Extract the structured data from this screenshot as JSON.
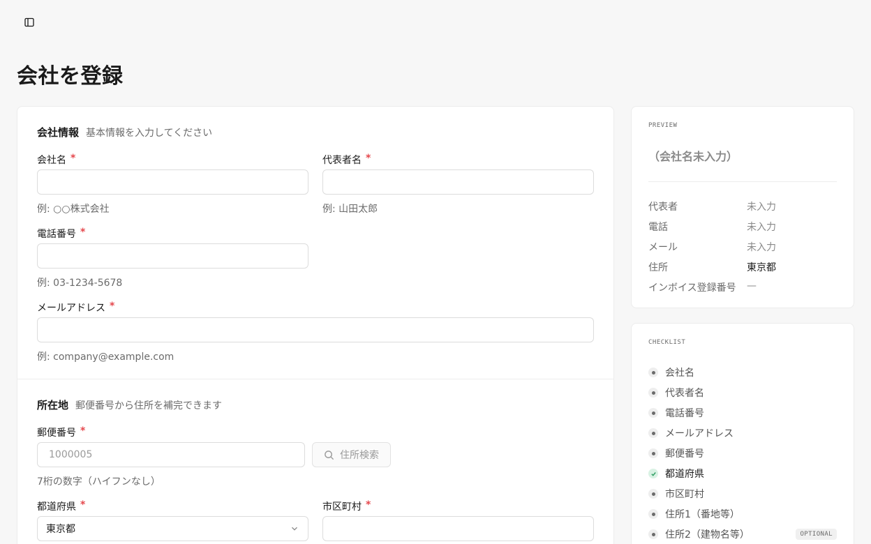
{
  "page": {
    "title": "会社を登録"
  },
  "company_section": {
    "title": "会社情報",
    "subtitle": "基本情報を入力してください",
    "fields": {
      "company_name": {
        "label": "会社名",
        "required": "*",
        "value": "",
        "hint": "例: ○○株式会社"
      },
      "representative": {
        "label": "代表者名",
        "required": "*",
        "value": "",
        "hint": "例: 山田太郎"
      },
      "phone": {
        "label": "電話番号",
        "required": "*",
        "value": "",
        "hint": "例: 03-1234-5678"
      },
      "email": {
        "label": "メールアドレス",
        "required": "*",
        "value": "",
        "hint": "例: company@example.com"
      }
    }
  },
  "address_section": {
    "title": "所在地",
    "subtitle": "郵便番号から住所を補完できます",
    "fields": {
      "postal": {
        "label": "郵便番号",
        "required": "*",
        "placeholder": "1000005",
        "hint": "7桁の数字（ハイフンなし）"
      },
      "search_button": "住所検索",
      "prefecture": {
        "label": "都道府県",
        "required": "*",
        "value": "東京都"
      },
      "city": {
        "label": "市区町村",
        "required": "*",
        "value": ""
      }
    }
  },
  "preview": {
    "heading": "PREVIEW",
    "company_name_placeholder": "（会社名未入力）",
    "rows": [
      {
        "key": "代表者",
        "value": "未入力",
        "filled": false
      },
      {
        "key": "電話",
        "value": "未入力",
        "filled": false
      },
      {
        "key": "メール",
        "value": "未入力",
        "filled": false
      },
      {
        "key": "住所",
        "value": "東京都",
        "filled": true
      },
      {
        "key": "インボイス登録番号",
        "value": "—",
        "filled": false
      }
    ]
  },
  "checklist": {
    "heading": "CHECKLIST",
    "items": [
      {
        "label": "会社名",
        "done": false
      },
      {
        "label": "代表者名",
        "done": false
      },
      {
        "label": "電話番号",
        "done": false
      },
      {
        "label": "メールアドレス",
        "done": false
      },
      {
        "label": "郵便番号",
        "done": false
      },
      {
        "label": "都道府県",
        "done": true
      },
      {
        "label": "市区町村",
        "done": false
      },
      {
        "label": "住所1（番地等）",
        "done": false
      },
      {
        "label": "住所2（建物名等）",
        "done": false,
        "badge": "OPTIONAL"
      }
    ]
  },
  "colors": {
    "required": "#e5484d",
    "done_bg": "#d9f2e4",
    "done_check": "#2f9e63"
  },
  "icons": {
    "sidebar_toggle": "sidebar-toggle-icon",
    "search": "search-icon",
    "chevron": "chevron-down-icon",
    "check": "check-icon"
  }
}
